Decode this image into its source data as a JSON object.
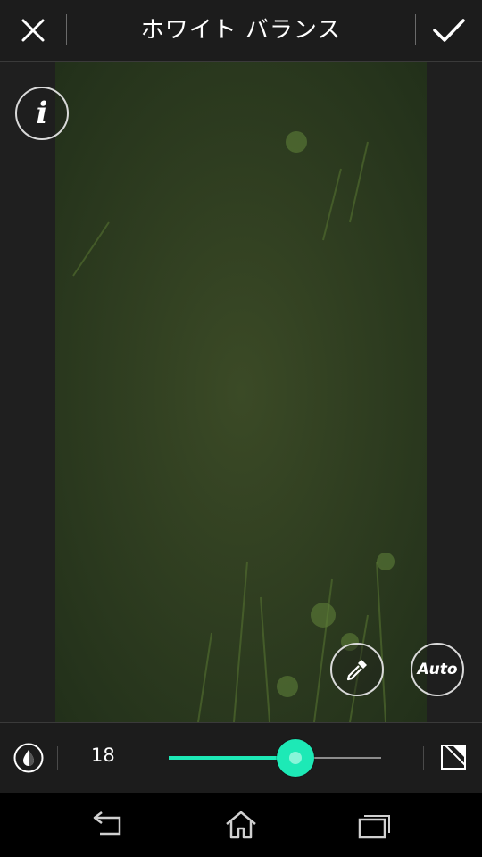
{
  "header": {
    "title": "ホワイト バランス"
  },
  "tools": {
    "auto_label": "Auto",
    "info_label": "i"
  },
  "adjustment": {
    "value": "18",
    "slider_fraction": 0.595,
    "accent_color": "#1de9b6"
  },
  "icons": {
    "close": "close-icon",
    "confirm": "checkmark-icon",
    "info": "info-icon",
    "eyedropper": "eyedropper-icon",
    "temperature": "drop-icon",
    "compare": "compare-icon",
    "back": "back-icon",
    "home": "home-icon",
    "recents": "recent-apps-icon"
  }
}
